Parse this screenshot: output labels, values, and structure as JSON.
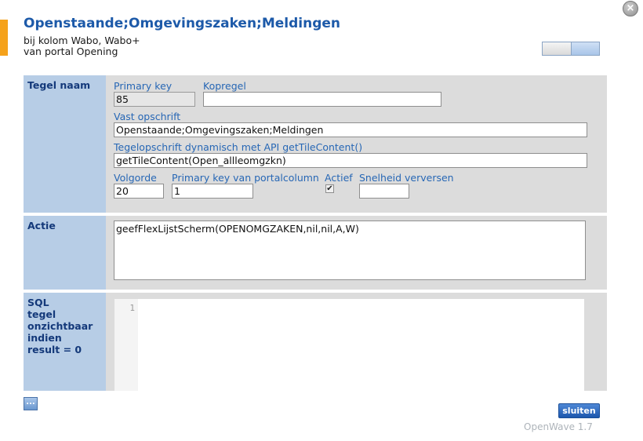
{
  "dialog": {
    "title": "Openstaande;Omgevingszaken;Meldingen",
    "subtitle_line1": "bij kolom Wabo, Wabo+",
    "subtitle_line2": "van portal Opening",
    "close_icon_glyph": "×",
    "accent_color": "#f5a21b"
  },
  "sections": {
    "tegel": {
      "label": "Tegel naam",
      "primary_key_label": "Primary key",
      "primary_key_value": "85",
      "kopregel_label": "Kopregel",
      "kopregel_value": "",
      "vast_label": "Vast opschrift",
      "vast_value": "Openstaande;Omgevingszaken;Meldingen",
      "dynamic_label": "Tegelopschrift dynamisch met API getTileContent()",
      "dynamic_value": "getTileContent(Open_allleomgzkn)",
      "volgorde_label": "Volgorde",
      "volgorde_value": "20",
      "portal_pk_label": "Primary key van portalcolumn",
      "portal_pk_value": "1",
      "actief_label": "Actief",
      "actief_checked": true,
      "actief_glyph": "✔",
      "snelheid_label": "Snelheid verversen",
      "snelheid_value": ""
    },
    "actie": {
      "label": "Actie",
      "value": "geefFlexLijstScherm(OPENOMGZAKEN,nil,nil,A,W)"
    },
    "sql": {
      "label_lines": [
        "SQL",
        "tegel",
        "onzichtbaar",
        "indien",
        "result = 0"
      ],
      "line_number": "1"
    }
  },
  "footer": {
    "more_button_label": "...",
    "close_button_label": "sluiten",
    "brand": "OpenWave 1.7"
  }
}
